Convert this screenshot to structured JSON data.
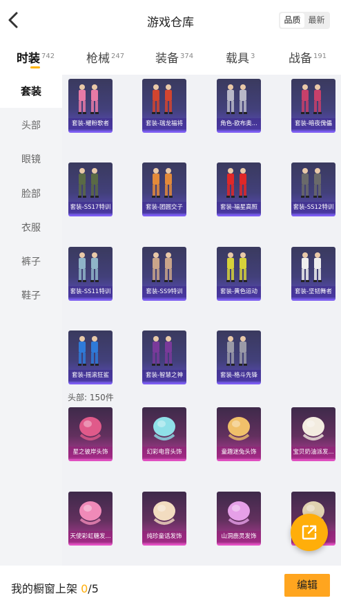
{
  "header": {
    "title": "游戏仓库",
    "sort_options": [
      {
        "label": "品质",
        "active": true
      },
      {
        "label": "最新",
        "active": false
      }
    ]
  },
  "tabs": [
    {
      "label": "时装",
      "count": "742",
      "active": true
    },
    {
      "label": "枪械",
      "count": "247",
      "active": false
    },
    {
      "label": "装备",
      "count": "374",
      "active": false
    },
    {
      "label": "载具",
      "count": "3",
      "active": false
    },
    {
      "label": "战备",
      "count": "191",
      "active": false
    }
  ],
  "sidebar": {
    "items": [
      {
        "label": "套装",
        "active": true
      },
      {
        "label": "头部",
        "active": false
      },
      {
        "label": "眼镜",
        "active": false
      },
      {
        "label": "脸部",
        "active": false
      },
      {
        "label": "衣服",
        "active": false
      },
      {
        "label": "裤子",
        "active": false
      },
      {
        "label": "鞋子",
        "active": false
      }
    ]
  },
  "suits": [
    {
      "name": "套装-耀粉歌者",
      "icon": "outfit-pink-singer-icon",
      "accent": "#e77aa6"
    },
    {
      "name": "套装-瑞龙福将",
      "icon": "outfit-dragon-general-icon",
      "accent": "#d2452f"
    },
    {
      "name": "角色-欧布奥...",
      "icon": "character-ob-icon",
      "accent": "#b8b8c8"
    },
    {
      "name": "套装-暗夜傀儡",
      "icon": "outfit-night-puppet-icon",
      "accent": "#c7406a"
    },
    {
      "name": "套装-SS17特训",
      "icon": "outfit-ss17-icon",
      "accent": "#5a6a45"
    },
    {
      "name": "套装-团圆交子",
      "icon": "outfit-reunion-icon",
      "accent": "#e38a3a"
    },
    {
      "name": "套装-福星高照",
      "icon": "outfit-lucky-star-icon",
      "accent": "#e02828"
    },
    {
      "name": "套装-SS12特训",
      "icon": "outfit-ss12-icon",
      "accent": "#6a6a6a"
    },
    {
      "name": "套装-SS11特训",
      "icon": "outfit-ss11-icon",
      "accent": "#8fb4c8"
    },
    {
      "name": "套装-SS9特训",
      "icon": "outfit-ss9-icon",
      "accent": "#c9a58a"
    },
    {
      "name": "套装-黄色运动",
      "icon": "outfit-yellow-sport-icon",
      "accent": "#d6d23a"
    },
    {
      "name": "套装-坚韧舞者",
      "icon": "outfit-dancer-icon",
      "accent": "#eeeeee"
    },
    {
      "name": "套装-摇滚狂鲨",
      "icon": "outfit-rock-shark-icon",
      "accent": "#2f7ad8"
    },
    {
      "name": "套装-智慧之神",
      "icon": "outfit-wisdom-god-icon",
      "accent": "#7a3a9a"
    },
    {
      "name": "套装-格斗先锋",
      "icon": "outfit-fighter-icon",
      "accent": "#9a9aa8"
    }
  ],
  "head_section": {
    "label": "头部: 150件"
  },
  "headwear": [
    {
      "name": "星之彼岸头饰",
      "icon": "headwear-star-icon",
      "accent": "#e05a8a"
    },
    {
      "name": "幻彩电音头饰",
      "icon": "headwear-electro-icon",
      "accent": "#8fe0e8"
    },
    {
      "name": "童趣迷兔头饰",
      "icon": "headwear-bunny-icon",
      "accent": "#f0c06a"
    },
    {
      "name": "宝贝奶油派发...",
      "icon": "headwear-cream-icon",
      "accent": "#f3ece0"
    },
    {
      "name": "天使彩虹糖发...",
      "icon": "headwear-rainbow-icon",
      "accent": "#f08ab8"
    },
    {
      "name": "纯珍童话发饰",
      "icon": "headwear-fairy-icon",
      "accent": "#f2dcc0"
    },
    {
      "name": "山洞鹿灵发饰",
      "icon": "headwear-deer-icon",
      "accent": "#e6a0e8"
    },
    {
      "name": "",
      "icon": "headwear-hidden-icon",
      "accent": "#e0d2b0"
    }
  ],
  "bottom": {
    "showcase_label": "我的橱窗上架",
    "showcase_current": "0",
    "showcase_total": "/5",
    "edit_label": "编辑"
  }
}
